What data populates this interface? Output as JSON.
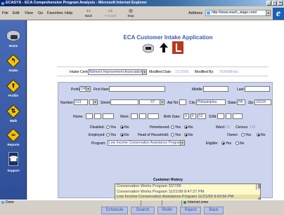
{
  "window": {
    "title": "ECASYS - ECA Comprehensive Program Analysis - Microsoft Internet Explorer",
    "buttons": [
      "_",
      "□",
      "×"
    ]
  },
  "menu": [
    "File",
    "Edit",
    "View",
    "Go",
    "Favorites",
    "Help"
  ],
  "toolbar": {
    "back": "Back",
    "forward": "Forward",
    "stop": "Stop"
  },
  "address": {
    "label": "Address",
    "url": "http://www.reach_stage.com/"
  },
  "nav": [
    {
      "label": "Home",
      "icon": "eca-logo-icon"
    },
    {
      "label": "Intake",
      "icon": "intake-sign-icon"
    },
    {
      "label": "Profile",
      "icon": "profile-sign-icon"
    },
    {
      "label": "Walk",
      "icon": "walk-sign-icon"
    },
    {
      "label": "Reports",
      "icon": "reports-sign-icon"
    },
    {
      "label": "Support",
      "icon": "phone-icon"
    }
  ],
  "app": {
    "title": "ECA Customer Intake Application"
  },
  "header": {
    "intake_center_label": "Intake Center:",
    "intake_center_value": "Belmont Improvement Association",
    "modified_date_label": "Modified Date:",
    "modified_date_value": "1/1/2000",
    "modified_by_label": "Modified By:",
    "modified_by_value": "TENNIBrida"
  },
  "form": {
    "prefix_label": "Prefix:",
    "prefix_value": "DR",
    "first_name_label": "First Name:",
    "middle_label": "Middle",
    "last_label": "Last:",
    "number_label": "Number:",
    "number_value": "613",
    "street_label": "Street:",
    "street_type_value": "ST",
    "apt_label": "Apt No:",
    "city_label": "City:",
    "city_value": "Philadelphia",
    "state_label": "State:",
    "state_value": "PA",
    "zip_label": "Zip:",
    "zip_value": "19104",
    "home_label": "Home:",
    "work_label": "Work:",
    "birth_date_label": "Birth Date:",
    "birth_month": "9",
    "birth_day": "6",
    "birth_year": "52",
    "ssn_label": "SSN:",
    "disabled_label": "Disabled:",
    "homebound_label": "Homebound:",
    "ward_label": "Ward:",
    "ward_value": "18",
    "census_label": "Census:",
    "census_value": "158",
    "employed_label": "Employed:",
    "head_label": "Head of Household:",
    "owner_label": "Owner:",
    "yes": "Yes",
    "no": "No",
    "program_label": "Program:",
    "program_value": "Low Income Conservation Assistance Program",
    "eligible_label": "Eligible:"
  },
  "history": {
    "label": "Customer History",
    "items": [
      "Conservation Works Program 3/27/95",
      "Conservation Works Program 11/21/99 8:47:27 PM",
      "Low Income Conservation Assistance Program 11/21/99 9:43:56 PM"
    ]
  },
  "actions": [
    "Schedule",
    "Search",
    "Refer",
    "Reject",
    "Back"
  ],
  "status": {
    "text": "Done",
    "zone": "Internet zone"
  },
  "colors": {
    "nav_bg": "#3a5ba8",
    "form_bg": "#ccd4ee",
    "accent": "#3c5aa6",
    "history_bg": "#fff8c8"
  }
}
